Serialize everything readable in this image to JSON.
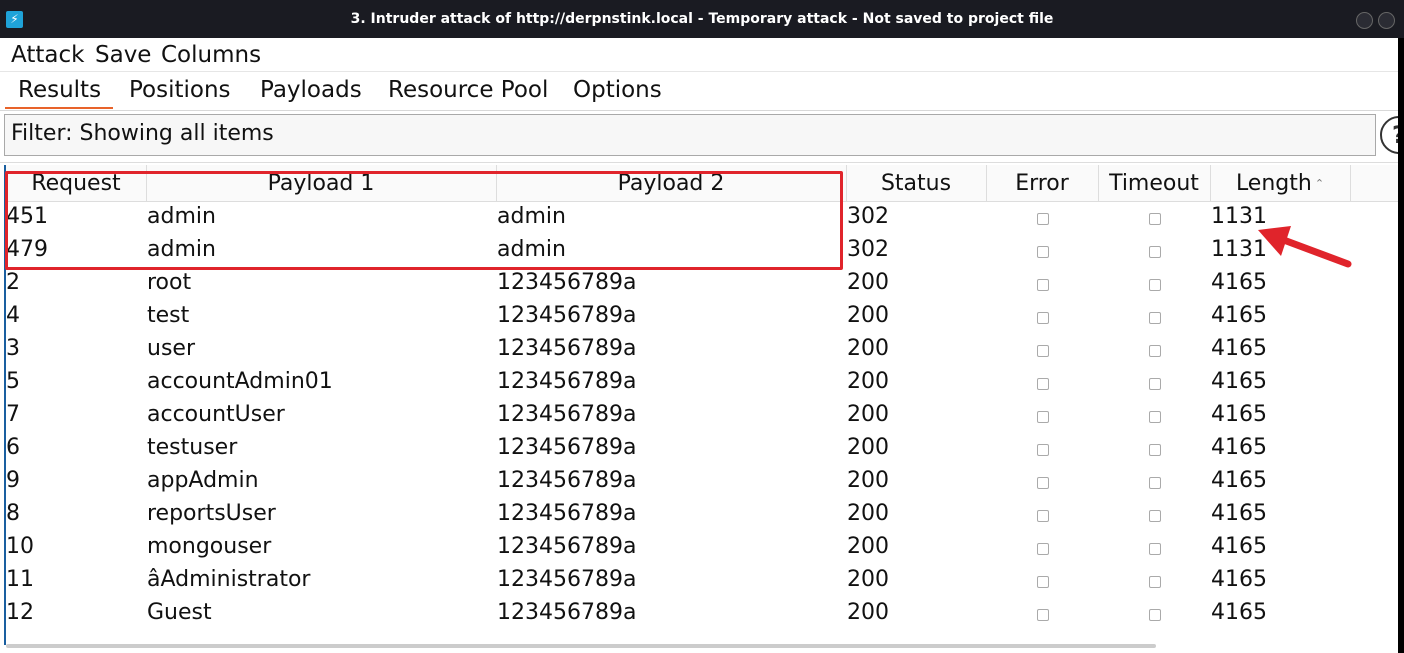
{
  "window": {
    "title": "3. Intruder attack of http://derpnstink.local - Temporary attack - Not saved to project file"
  },
  "menu": {
    "attack": "Attack",
    "save": "Save",
    "columns": "Columns"
  },
  "tabs": {
    "results": "Results",
    "positions": "Positions",
    "payloads": "Payloads",
    "resource_pool": "Resource Pool",
    "options": "Options",
    "active": "Results"
  },
  "filter": {
    "text": "Filter: Showing all items",
    "help": "?"
  },
  "table": {
    "headers": {
      "request": "Request",
      "payload1": "Payload 1",
      "payload2": "Payload 2",
      "status": "Status",
      "error": "Error",
      "timeout": "Timeout",
      "length": "Length"
    },
    "sorted_by": "Length",
    "rows": [
      {
        "request": "451",
        "payload1": "admin",
        "payload2": "admin",
        "status": "302",
        "error": false,
        "timeout": false,
        "length": "1131"
      },
      {
        "request": "479",
        "payload1": "admin",
        "payload2": "admin",
        "status": "302",
        "error": false,
        "timeout": false,
        "length": "1131"
      },
      {
        "request": "2",
        "payload1": "root",
        "payload2": "123456789a",
        "status": "200",
        "error": false,
        "timeout": false,
        "length": "4165"
      },
      {
        "request": "4",
        "payload1": "test",
        "payload2": "123456789a",
        "status": "200",
        "error": false,
        "timeout": false,
        "length": "4165"
      },
      {
        "request": "3",
        "payload1": "user",
        "payload2": "123456789a",
        "status": "200",
        "error": false,
        "timeout": false,
        "length": "4165"
      },
      {
        "request": "5",
        "payload1": "accountAdmin01",
        "payload2": "123456789a",
        "status": "200",
        "error": false,
        "timeout": false,
        "length": "4165"
      },
      {
        "request": "7",
        "payload1": "accountUser",
        "payload2": "123456789a",
        "status": "200",
        "error": false,
        "timeout": false,
        "length": "4165"
      },
      {
        "request": "6",
        "payload1": "testuser",
        "payload2": "123456789a",
        "status": "200",
        "error": false,
        "timeout": false,
        "length": "4165"
      },
      {
        "request": "9",
        "payload1": "appAdmin",
        "payload2": "123456789a",
        "status": "200",
        "error": false,
        "timeout": false,
        "length": "4165"
      },
      {
        "request": "8",
        "payload1": "reportsUser",
        "payload2": "123456789a",
        "status": "200",
        "error": false,
        "timeout": false,
        "length": "4165"
      },
      {
        "request": "10",
        "payload1": "mongouser",
        "payload2": "123456789a",
        "status": "200",
        "error": false,
        "timeout": false,
        "length": "4165"
      },
      {
        "request": "11",
        "payload1": "âAdministrator",
        "payload2": "123456789a",
        "status": "200",
        "error": false,
        "timeout": false,
        "length": "4165"
      },
      {
        "request": "12",
        "payload1": "Guest",
        "payload2": "123456789a",
        "status": "200",
        "error": false,
        "timeout": false,
        "length": "4165"
      }
    ]
  },
  "colors": {
    "highlight_box": "#e0242b",
    "arrow": "#e0242b",
    "active_tab": "#e8632a",
    "app_icon": "#1fa3d9"
  }
}
